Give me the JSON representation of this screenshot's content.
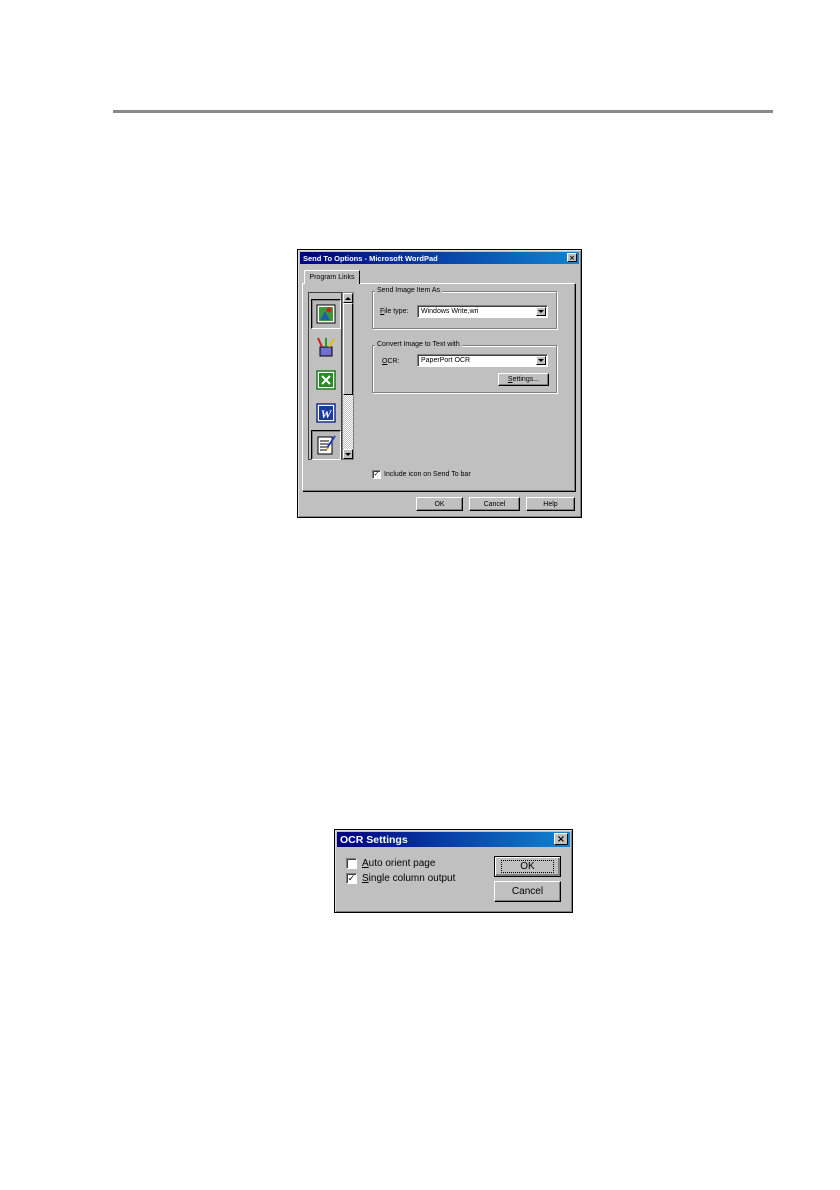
{
  "sendto": {
    "title": "Send To Options - Microsoft WordPad",
    "close_glyph": "×",
    "tab_label": "Program Links",
    "group1_label": "Send Image Item As",
    "filetype_label_u": "F",
    "filetype_label_rest": "ile type:",
    "filetype_value": "Windows Write,wri",
    "group2_label": "Convert Image to Text with",
    "ocr_label_u": "O",
    "ocr_label_rest": "CR:",
    "ocr_value": "PaperPort OCR",
    "settings_u": "S",
    "settings_rest": "ettings...",
    "include_check": "✓",
    "include_label": "Include icon on Send To bar",
    "ok_label": "OK",
    "cancel_label": "Cancel",
    "help_label": "Help"
  },
  "ocr": {
    "title": "OCR Settings",
    "close_glyph": "×",
    "auto_orient_u": "A",
    "auto_orient_rest": "uto orient page",
    "auto_orient_check": "",
    "single_col_u": "S",
    "single_col_rest": "ingle column output",
    "single_col_check": "✓",
    "ok_label": "OK",
    "cancel_label": "Cancel"
  },
  "colors": {
    "title_start": "#000080",
    "title_end": "#1084d0",
    "face": "#c0c0c0"
  }
}
